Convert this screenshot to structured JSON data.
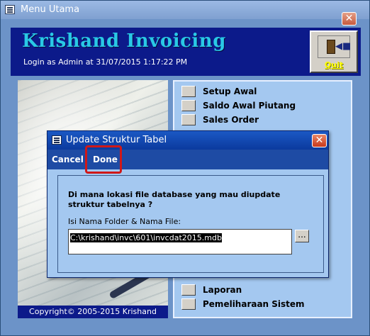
{
  "main_window": {
    "title": "Menu Utama",
    "app_title": "Krishand Invoicing",
    "login_text": "Login as Admin at 31/07/2015 1:17:22 PM",
    "quit_label": "Quit",
    "copyright": "Copyright© 2005-2015 Krishand"
  },
  "menu": {
    "items": [
      {
        "label": "Setup Awal"
      },
      {
        "label": "Saldo Awal Piutang"
      },
      {
        "label": "Sales Order"
      },
      {
        "label": "Laporan"
      },
      {
        "label": "Pemeliharaan Sistem"
      }
    ]
  },
  "dialog": {
    "title": "Update Struktur Tabel",
    "cancel_label": "Cancel",
    "done_label": "Done",
    "question": "Di mana lokasi file database yang mau diupdate struktur tabelnya ?",
    "field_label": "Isi Nama Folder & Nama File:",
    "path_value": "C:\\krishand\\invc\\601\\invcdat2015.mdb",
    "browse_label": "..."
  },
  "icons": {
    "window_icon": "form-icon",
    "close": "close-icon",
    "quit": "exit-door-icon"
  },
  "colors": {
    "header_bg": "#0c1a8a",
    "title_text": "#29c9e6",
    "quit_text": "#ffff00",
    "panel_bg": "#a4c8f0",
    "dialog_titlebar": "#1b58c4",
    "highlight": "#d01818"
  }
}
